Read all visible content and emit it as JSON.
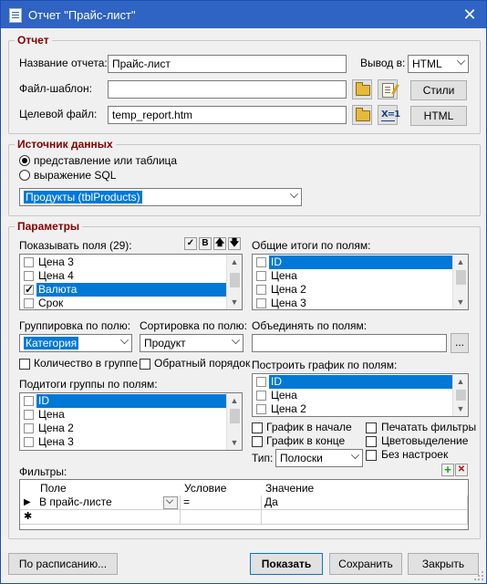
{
  "window": {
    "title": "Отчет \"Прайс-лист\"",
    "close_glyph": "✕"
  },
  "report": {
    "legend": "Отчет",
    "name_label": "Название отчета:",
    "name_value": "Прайс-лист",
    "output_label": "Вывод в:",
    "output_value": "HTML",
    "template_label": "Файл-шаблон:",
    "template_value": "",
    "target_label": "Целевой файл:",
    "target_value": "temp_report.htm",
    "styles_button": "Стили",
    "html_button": "HTML",
    "xl_glyph": "X=1"
  },
  "datasource": {
    "legend": "Источник данных",
    "option_view": "представление или таблица",
    "option_sql": "выражение SQL",
    "selected": "Продукты (tblProducts)"
  },
  "params": {
    "legend": "Параметры",
    "show_fields_label": "Показывать поля (29):",
    "show_fields": [
      {
        "text": "Цена 3",
        "checked": false,
        "selected": false
      },
      {
        "text": "Цена 4",
        "checked": false,
        "selected": false
      },
      {
        "text": "Валюта",
        "checked": true,
        "selected": true
      },
      {
        "text": "Срок",
        "checked": false,
        "selected": false
      }
    ],
    "toolbar": {
      "check_all": "✓",
      "bold": "B",
      "up": "🡅",
      "down": "🡇"
    },
    "totals_label": "Общие итоги по полям:",
    "totals": [
      {
        "text": "ID",
        "selected": true
      },
      {
        "text": "Цена",
        "selected": false
      },
      {
        "text": "Цена 2",
        "selected": false
      },
      {
        "text": "Цена 3",
        "selected": false
      }
    ],
    "group_label": "Группировка по полю:",
    "group_value": "Категория",
    "sort_label": "Сортировка по полю:",
    "sort_value": "Продукт",
    "merge_label": "Объединять по полям:",
    "merge_value": "",
    "merge_button": "...",
    "count_in_group": "Количество в группе",
    "reverse_order": "Обратный порядок",
    "subtotals_label": "Подитоги группы по полям:",
    "subtotals": [
      {
        "text": "ID",
        "selected": true
      },
      {
        "text": "Цена",
        "selected": false
      },
      {
        "text": "Цена 2",
        "selected": false
      },
      {
        "text": "Цена 3",
        "selected": false
      }
    ],
    "chart_label": "Построить график по полям:",
    "chart_fields": [
      {
        "text": "ID",
        "selected": true
      },
      {
        "text": "Цена",
        "selected": false
      },
      {
        "text": "Цена 2",
        "selected": false
      }
    ],
    "chart_at_start": "График в начале",
    "chart_at_end": "График в конце",
    "print_filters": "Печатать фильтры",
    "color_highlight": "Цветовыделение",
    "no_settings": "Без настроек",
    "type_label": "Тип:",
    "type_value": "Полоски"
  },
  "filters": {
    "label": "Фильтры:",
    "columns": [
      "Поле",
      "Условие",
      "Значение"
    ],
    "rows": [
      {
        "marker": "▶",
        "field": "В прайс-листе",
        "condition": "=",
        "value": "Да"
      }
    ],
    "new_row_marker": "✱",
    "add_glyph": "+",
    "remove_glyph": "✕"
  },
  "footer": {
    "schedule_button": "По расписанию...",
    "show_button": "Показать",
    "save_button": "Сохранить",
    "close_button": "Закрыть"
  }
}
